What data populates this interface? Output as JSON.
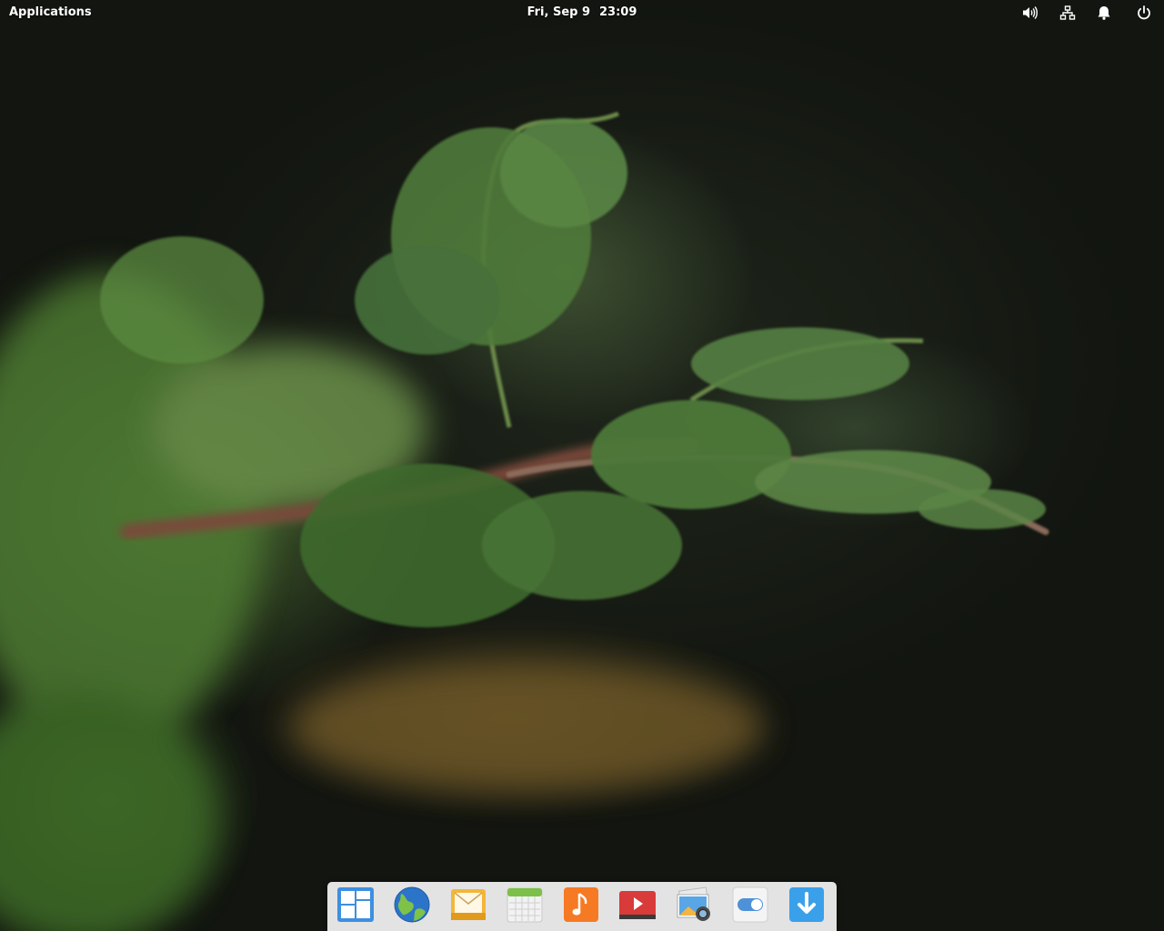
{
  "panel": {
    "applications_label": "Applications",
    "date": "Fri, Sep  9",
    "time": "23:09",
    "indicators": [
      "volume-icon",
      "network-icon",
      "notifications-icon",
      "power-icon"
    ]
  },
  "dock": {
    "items": [
      {
        "icon": "multitasking-view-icon"
      },
      {
        "icon": "web-browser-icon"
      },
      {
        "icon": "mail-icon"
      },
      {
        "icon": "calendar-icon"
      },
      {
        "icon": "music-icon"
      },
      {
        "icon": "videos-icon"
      },
      {
        "icon": "photos-icon"
      },
      {
        "icon": "system-settings-icon"
      },
      {
        "icon": "appcenter-icon"
      }
    ]
  },
  "colors": {
    "dock_background": "#f5f5f5",
    "panel_text": "#ffffff"
  }
}
